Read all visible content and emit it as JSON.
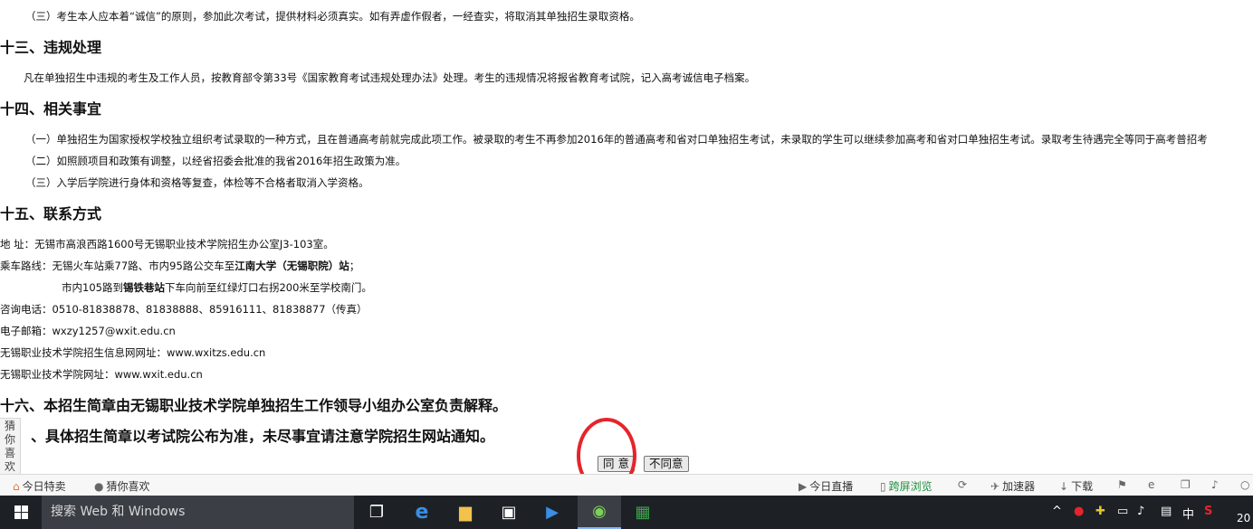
{
  "document": {
    "lines": [
      "（三）考生本人应本着“诚信”的原则，参加此次考试，提供材料必须真实。如有弄虚作假者，一经查实，将取消其单独招生录取资格。",
      "凡在单独招生中违规的考生及工作人员，按教育部令第33号《国家教育考试违规处理办法》处理。考生的违规情况将报省教育考试院，记入高考诚信电子档案。",
      "（一）单独招生为国家授权学校独立组织考试录取的一种方式，且在普通高考前就完成此项工作。被录取的考生不再参加2016年的普通高考和省对口单独招生考试，未录取的学生可以继续参加高考和省对口单独招生考试。录取考生待遇完全等同于高考普招考",
      "（二）如照顾项目和政策有调整，以经省招委会批准的我省2016年招生政策为准。",
      "（三）入学后学院进行身体和资格等复查，体检等不合格者取消入学资格。"
    ],
    "headings": {
      "h13": "十三、违规处理",
      "h14": "十四、相关事宜",
      "h15": "十五、联系方式",
      "h16": "十六、本招生简章由无锡职业技术学院单独招生工作领导小组办公室负责解释。",
      "h17": "、具体招生简章以考试院公布为准，未尽事宜请注意学院招生网站通知。"
    },
    "contact": {
      "address": "地    址：无锡市高浪西路1600号无锡职业技术学院招生办公室J3-103室。",
      "route_prefix": "乘车路线：无锡火车站乘77路、市内95路公交车至",
      "route_bold1": "江南大学（无锡职院）站",
      "route_suffix": "；",
      "route2_prefix": "市内105路到",
      "route2_bold": "锡铁巷站",
      "route2_suffix": "下车向前至红绿灯口右拐200米至学校南门。",
      "phone": "咨询电话：0510-81838878、81838888、85916111、81838877（传真）",
      "email": "电子邮箱：wxzy1257@wxit.edu.cn",
      "admission_site": "无锡职业技术学院招生信息网网址：www.wxitzs.edu.cn",
      "site": "无锡职业技术学院网址：www.wxit.edu.cn"
    }
  },
  "side_tab": {
    "label": "猜你喜欢"
  },
  "buttons": {
    "agree": "同 意",
    "disagree": "不同意"
  },
  "statusbar": {
    "left": [
      "今日特卖",
      "猜你喜欢"
    ],
    "right": [
      "今日直播",
      "跨屏浏览",
      "加速器",
      "下载"
    ]
  },
  "taskbar": {
    "search_placeholder": "搜索 Web 和 Windows",
    "ime": "中",
    "clock": "20"
  },
  "colors": {
    "highlight_ring": "#e5242c",
    "taskbar_bg": "#1d2126",
    "status_green": "#1f8f3d"
  }
}
